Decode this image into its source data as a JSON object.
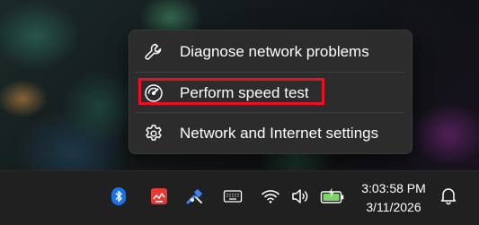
{
  "context_menu": {
    "items": [
      {
        "label": "Diagnose network problems",
        "icon": "wrench-icon"
      },
      {
        "label": "Perform speed test",
        "icon": "speedometer-icon"
      },
      {
        "label": "Network and Internet settings",
        "icon": "gear-icon"
      }
    ],
    "highlight_color": "#e81123"
  },
  "taskbar": {
    "tray_icons": [
      {
        "name": "bluetooth-icon",
        "color": "#1a73e8"
      },
      {
        "name": "app-red-monitor-icon",
        "color": "#e53935"
      },
      {
        "name": "network-tool-icon",
        "color": "#3b82f6"
      },
      {
        "name": "keyboard-icon",
        "color": "#ffffff"
      },
      {
        "name": "wifi-icon",
        "color": "#ffffff"
      },
      {
        "name": "volume-icon",
        "color": "#ffffff"
      },
      {
        "name": "battery-charging-icon",
        "color": "#7fd36b"
      }
    ],
    "clock": {
      "time": "3:03:58 PM",
      "date": "3/11/2026"
    },
    "notification_icon": "bell-icon"
  }
}
